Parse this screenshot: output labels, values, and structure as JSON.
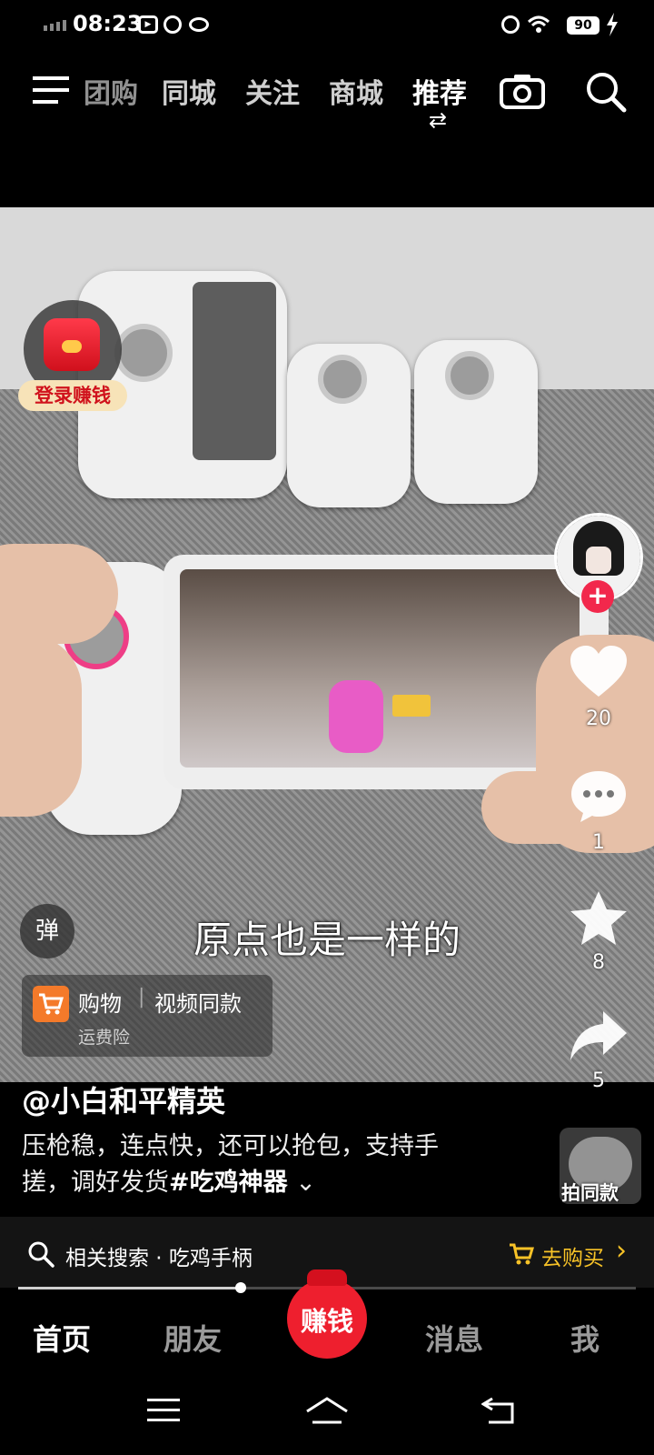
{
  "status_bar": {
    "time": "08:23",
    "battery": "90"
  },
  "top_nav": {
    "tabs": [
      "团购",
      "同城",
      "关注",
      "商城",
      "推荐"
    ],
    "active_tab": "推荐"
  },
  "video": {
    "subtitle": "原点也是一样的"
  },
  "overlay": {
    "login_earn_label": "登录赚钱",
    "danmaku_label": "弹",
    "shop_card": {
      "title": "购物",
      "separator": "|",
      "same_item": "视频同款",
      "subtitle": "运费险"
    }
  },
  "right_rail": {
    "follow_symbol": "+",
    "likes": "20",
    "comments": "1",
    "favorites": "8",
    "shares": "5",
    "template_label": "拍同款"
  },
  "post": {
    "author": "@小白和平精英",
    "desc_line1": "压枪稳，连点快，还可以抢包，支持手",
    "desc_line2": "搓，调好发货",
    "hashtag": "#吃鸡神器",
    "expand_symbol": "⌄"
  },
  "related": {
    "text": "相关搜索 · 吃鸡手柄",
    "buy_label": "去购买",
    "buy_arrow": "›"
  },
  "playback": {
    "progress": 0.36
  },
  "bottom_tabs": {
    "home": "首页",
    "friends": "朋友",
    "earn": "赚钱",
    "messages": "消息",
    "me": "我"
  }
}
